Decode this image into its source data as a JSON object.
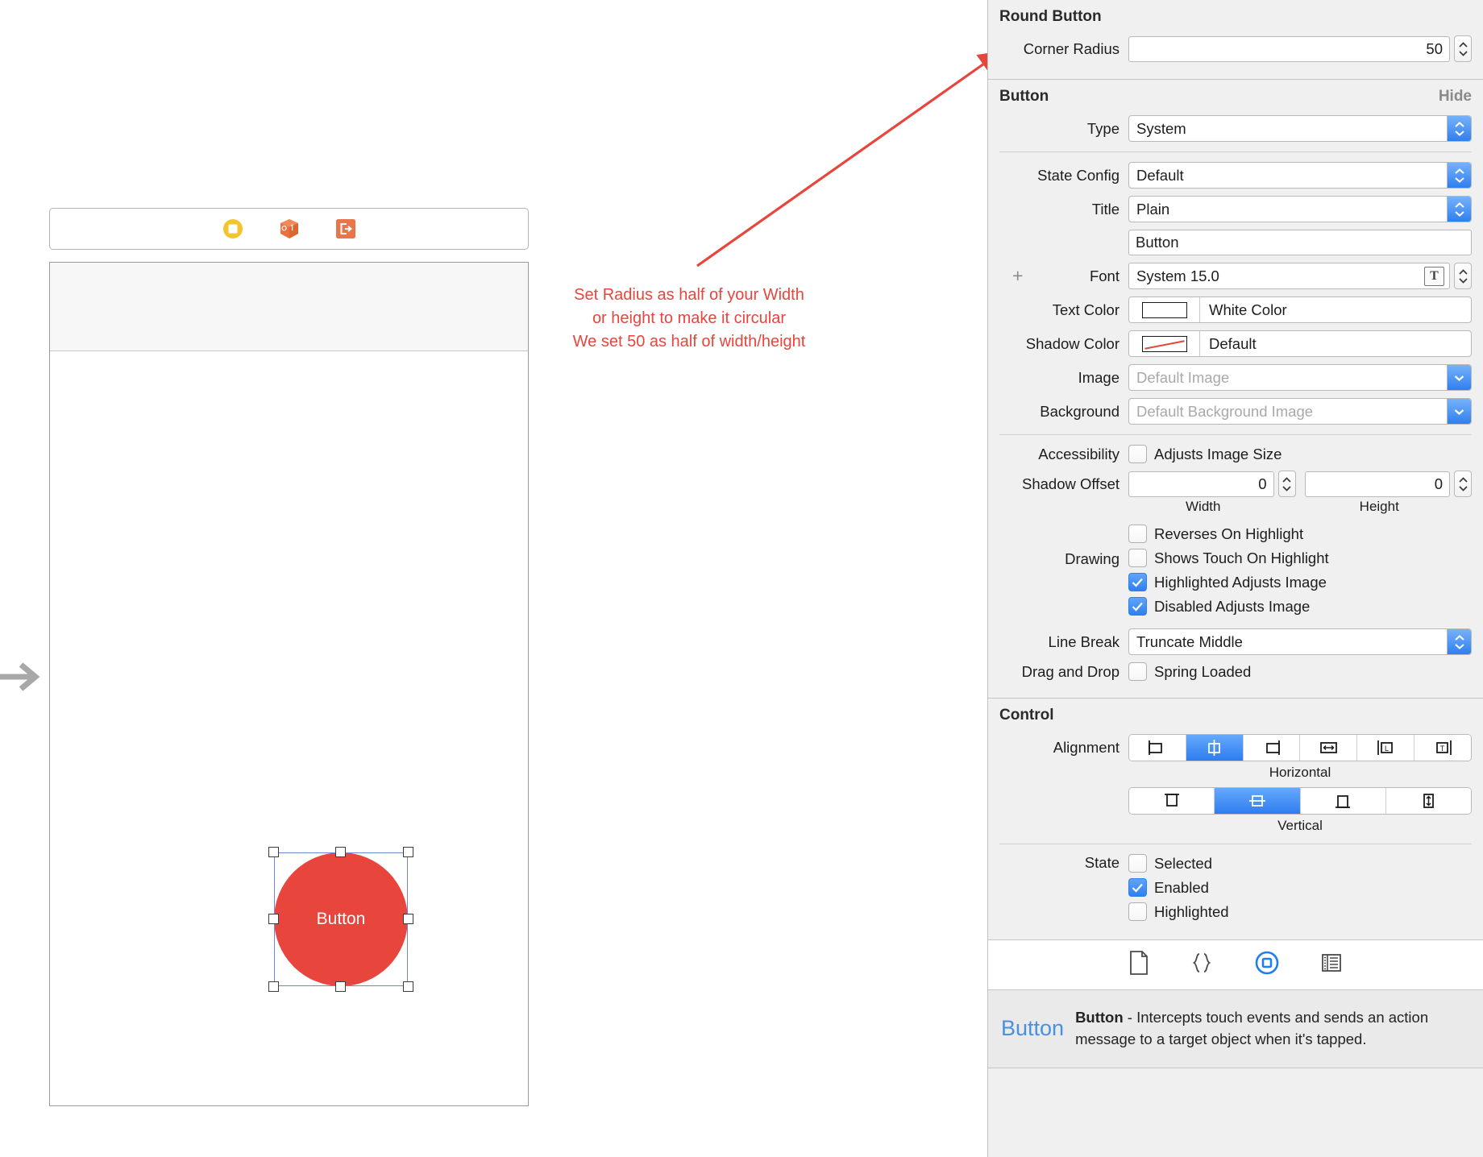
{
  "canvas": {
    "scene_icons": [
      "view-controller-icon",
      "first-responder-icon",
      "exit-icon"
    ],
    "button_title": "Button",
    "annotation": "Set Radius as half of your Width\nor height to make it circular\nWe set 50 as half of width/height",
    "annotation_color": "#e8453c",
    "button_color": "#e8453c"
  },
  "inspector": {
    "round_button": {
      "title": "Round Button",
      "corner_radius_label": "Corner Radius",
      "corner_radius_value": "50"
    },
    "button": {
      "title": "Button",
      "hide_label": "Hide",
      "type_label": "Type",
      "type_value": "System",
      "state_config_label": "State Config",
      "state_config_value": "Default",
      "title_label": "Title",
      "title_value": "Plain",
      "title_text_value": "Button",
      "font_label": "Font",
      "font_value": "System 15.0",
      "text_color_label": "Text Color",
      "text_color_value": "White Color",
      "shadow_color_label": "Shadow Color",
      "shadow_color_value": "Default",
      "image_label": "Image",
      "image_placeholder": "Default Image",
      "background_label": "Background",
      "background_placeholder": "Default Background Image",
      "accessibility_label": "Accessibility",
      "adjusts_image_size_label": "Adjusts Image Size",
      "adjusts_image_size_checked": false,
      "shadow_offset_label": "Shadow Offset",
      "shadow_offset_width": "0",
      "shadow_offset_height": "0",
      "width_sub_label": "Width",
      "height_sub_label": "Height",
      "drawing_label": "Drawing",
      "drawing_options": [
        {
          "label": "Reverses On Highlight",
          "checked": false
        },
        {
          "label": "Shows Touch On Highlight",
          "checked": false
        },
        {
          "label": "Highlighted Adjusts Image",
          "checked": true
        },
        {
          "label": "Disabled Adjusts Image",
          "checked": true
        }
      ],
      "line_break_label": "Line Break",
      "line_break_value": "Truncate Middle",
      "drag_and_drop_label": "Drag and Drop",
      "spring_loaded_label": "Spring Loaded",
      "spring_loaded_checked": false
    },
    "control": {
      "title": "Control",
      "alignment_label": "Alignment",
      "horizontal_sub_label": "Horizontal",
      "vertical_sub_label": "Vertical",
      "horizontal_selected_index": 1,
      "vertical_selected_index": 1,
      "horizontal_segments": [
        "align-left-icon",
        "align-center-icon",
        "align-right-icon",
        "align-fill-horizontal-icon",
        "align-leading-icon",
        "align-trailing-icon"
      ],
      "vertical_segments": [
        "align-top-icon",
        "align-middle-icon",
        "align-bottom-icon",
        "align-fill-vertical-icon"
      ],
      "state_label": "State",
      "state_options": [
        {
          "label": "Selected",
          "checked": false
        },
        {
          "label": "Enabled",
          "checked": true
        },
        {
          "label": "Highlighted",
          "checked": false
        }
      ]
    },
    "library_bar": {
      "icons": [
        "file-template-icon",
        "code-snippet-icon",
        "object-library-icon",
        "media-library-icon"
      ],
      "selected_index": 2,
      "accent_color": "#1f7ef0"
    },
    "library_description": {
      "keyword": "Button",
      "title": "Button",
      "text": " - Intercepts touch events and sends an action message to a target object when it's tapped."
    }
  }
}
